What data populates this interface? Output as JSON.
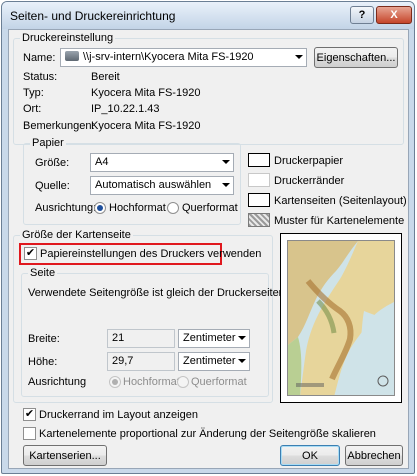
{
  "window": {
    "title": "Seiten- und Druckereinrichtung",
    "help_btn": "?",
    "close_btn": "X"
  },
  "drucker": {
    "group_label": "Druckereinstellung",
    "name_label": "Name:",
    "name_value": "\\\\j-srv-intern\\Kyocera Mita FS-1920",
    "properties_btn": "Eigenschaften...",
    "status_label": "Status:",
    "status_value": "Bereit",
    "typ_label": "Typ:",
    "typ_value": "Kyocera Mita FS-1920",
    "ort_label": "Ort:",
    "ort_value": "IP_10.22.1.43",
    "bem_label": "Bemerkungen:",
    "bem_value": "Kyocera Mita FS-1920"
  },
  "papier": {
    "group_label": "Papier",
    "groesse_label": "Größe:",
    "groesse_value": "A4",
    "quelle_label": "Quelle:",
    "quelle_value": "Automatisch auswählen",
    "ausrichtung_label": "Ausrichtung:",
    "hochformat": "Hochformat",
    "querformat": "Querformat"
  },
  "legend": {
    "druckerpapier": "Druckerpapier",
    "druckerraender": "Druckerränder",
    "kartenseiten": "Kartenseiten (Seitenlayout)",
    "muster": "Muster für Kartenelemente"
  },
  "kartenseite": {
    "group_label": "Größe der Kartenseite",
    "use_printer_label": "Papiereinstellungen des Druckers verwenden"
  },
  "seite": {
    "group_label": "Seite",
    "info": "Verwendete Seitengröße ist gleich der Druckerseitengröße",
    "breite_label": "Breite:",
    "breite_value": "21",
    "breite_unit": "Zentimeter",
    "hoehe_label": "Höhe:",
    "hoehe_value": "29,7",
    "hoehe_unit": "Zentimeter",
    "ausrichtung_label": "Ausrichtung",
    "hochformat": "Hochformat",
    "querformat": "Querformat"
  },
  "options": {
    "druckerrand": "Druckerrand im Layout anzeigen",
    "proportional": "Kartenelemente proportional zur Änderung der Seitengröße skalieren"
  },
  "buttons": {
    "kartenserien": "Kartenserien...",
    "ok": "OK",
    "abbrechen": "Abbrechen"
  }
}
